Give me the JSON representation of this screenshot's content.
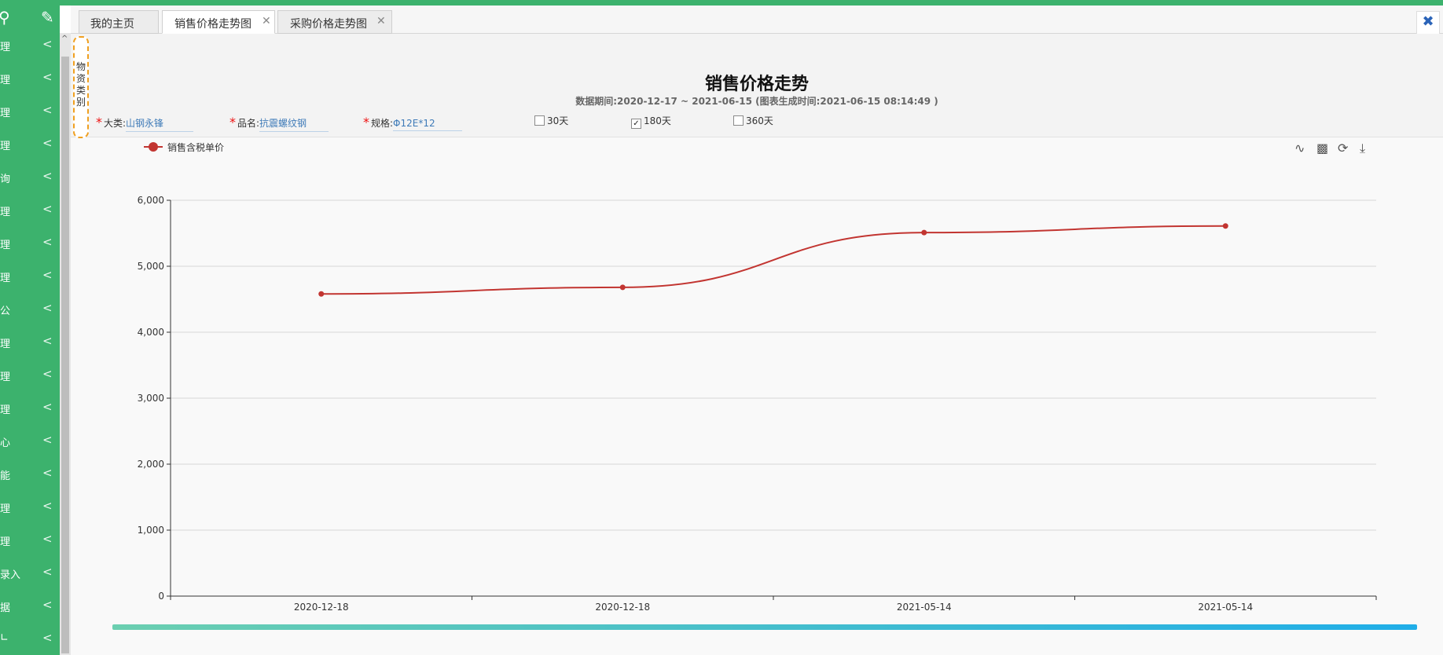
{
  "sidebar": {
    "items": [
      {
        "label": "理"
      },
      {
        "label": "理"
      },
      {
        "label": "理"
      },
      {
        "label": "理"
      },
      {
        "label": "询"
      },
      {
        "label": "理"
      },
      {
        "label": "理"
      },
      {
        "label": "理"
      },
      {
        "label": "公"
      },
      {
        "label": "理"
      },
      {
        "label": "理"
      },
      {
        "label": "理"
      },
      {
        "label": "心"
      },
      {
        "label": "能"
      },
      {
        "label": "理"
      },
      {
        "label": "理"
      },
      {
        "label": "录入"
      },
      {
        "label": "据"
      },
      {
        "label": "∟"
      }
    ],
    "arrow": "<"
  },
  "tabs": [
    {
      "label": "我的主页",
      "active": false,
      "closable": false
    },
    {
      "label": "销售价格走势图",
      "active": true,
      "closable": true
    },
    {
      "label": "采购价格走势图",
      "active": false,
      "closable": true
    }
  ],
  "close_all_label": "✖",
  "side_tag": [
    "物",
    "资",
    "类",
    "别"
  ],
  "filters": {
    "category": {
      "label": "大类:",
      "value": "山钢永锋"
    },
    "product": {
      "label": "品名:",
      "value": "抗震螺纹钢"
    },
    "spec": {
      "label": "规格:",
      "value": "Φ12E*12"
    }
  },
  "periods": [
    {
      "label": "30天",
      "checked": false
    },
    {
      "label": "180天",
      "checked": true
    },
    {
      "label": "360天",
      "checked": false
    }
  ],
  "toolbox_icons": [
    "line-chart-icon",
    "bar-chart-icon",
    "refresh-icon",
    "download-icon"
  ],
  "chart_data": {
    "type": "line",
    "title": "销售价格走势",
    "subtitle": "数据期间:2020-12-17 ~ 2021-06-15 (图表生成时间:2021-06-15 08:14:49 )",
    "categories": [
      "2020-12-18",
      "2020-12-18",
      "2021-05-14",
      "2021-05-14"
    ],
    "series": [
      {
        "name": "销售含税单价",
        "values": [
          4580,
          4680,
          5510,
          5610
        ],
        "color": "#c23531",
        "smooth": true
      }
    ],
    "ylim": [
      0,
      6000
    ],
    "yticks": [
      0,
      1000,
      2000,
      3000,
      4000,
      5000,
      6000
    ],
    "ytick_labels": [
      "0",
      "1,000",
      "2,000",
      "3,000",
      "4,000",
      "5,000",
      "6,000"
    ],
    "grid": true,
    "legend": "top-left"
  }
}
